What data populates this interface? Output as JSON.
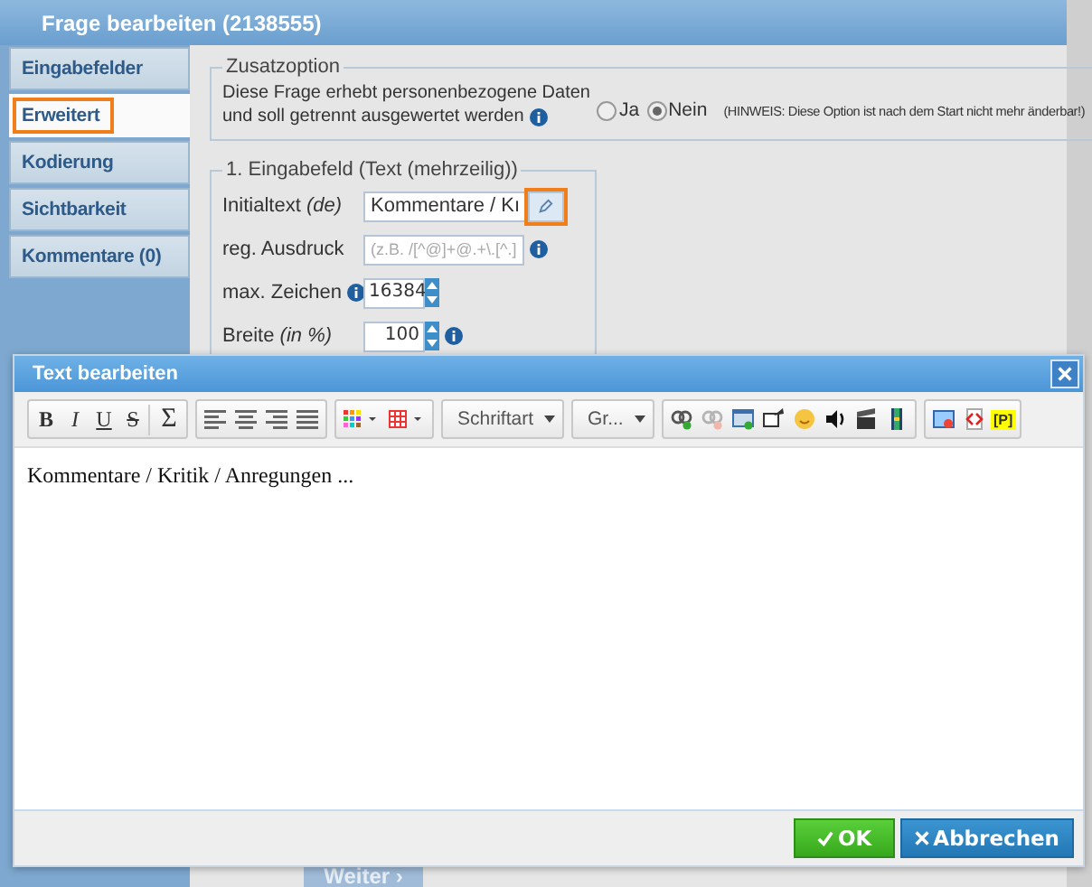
{
  "window": {
    "title": "Frage bearbeiten (2138555)"
  },
  "sidebar": {
    "items": [
      {
        "label": "Eingabefelder",
        "selected": false,
        "highlighted": false
      },
      {
        "label": "Erweitert",
        "selected": true,
        "highlighted": true
      },
      {
        "label": "Kodierung",
        "selected": false,
        "highlighted": false
      },
      {
        "label": "Sichtbarkeit",
        "selected": false,
        "highlighted": false
      },
      {
        "label": "Kommentare (0)",
        "selected": false,
        "highlighted": false
      }
    ]
  },
  "zusatzoption": {
    "legend": "Zusatzoption",
    "question_lines": [
      "Diese Frage erhebt personenbezogene Daten",
      "und soll getrennt ausgewertet werden"
    ],
    "options": [
      {
        "label": "Ja",
        "selected": false
      },
      {
        "label": "Nein",
        "selected": true
      }
    ],
    "hint": "(HINWEIS: Diese Option ist nach dem Start nicht mehr änderbar!)"
  },
  "field_settings": {
    "legend": "1. Eingabefeld (Text (mehrzeilig))",
    "rows": [
      {
        "kind": "text-edit",
        "label": "Initialtext *(de)*",
        "value": "Kommentare / Kı",
        "edit_highlighted": true
      },
      {
        "kind": "text",
        "label": "reg. Ausdruck",
        "placeholder": "(z.B. /[^@]+@.+\\.[^.]",
        "info_after_field": true
      },
      {
        "kind": "spinner",
        "label": "max. Zeichen",
        "value": "16384",
        "info_after_label": true
      },
      {
        "kind": "spinner",
        "label": "Breite *(in %)*",
        "value": "100",
        "info_after_field": true
      }
    ]
  },
  "next_button": {
    "label": "Weiter ›"
  },
  "dialog": {
    "title": "Text bearbeiten",
    "toolbar": [
      [
        {
          "kind": "bold",
          "label": "B"
        },
        {
          "kind": "italic",
          "label": "I"
        },
        {
          "kind": "underline",
          "label": "U"
        },
        {
          "kind": "strike",
          "label": "S"
        },
        {
          "kind": "sigma",
          "label": "Σ"
        }
      ],
      [
        {
          "kind": "align-left"
        },
        {
          "kind": "align-center"
        },
        {
          "kind": "align-right"
        },
        {
          "kind": "align-justify"
        }
      ],
      [
        {
          "kind": "colors"
        },
        {
          "kind": "table"
        }
      ],
      [
        {
          "kind": "dropdown",
          "label": "Schriftart"
        }
      ],
      [
        {
          "kind": "dropdown",
          "label": "Gr..."
        }
      ],
      [
        {
          "kind": "link"
        },
        {
          "kind": "unlink"
        },
        {
          "kind": "image"
        },
        {
          "kind": "embed"
        },
        {
          "kind": "smiley"
        },
        {
          "kind": "sound"
        },
        {
          "kind": "video"
        },
        {
          "kind": "film"
        }
      ],
      [
        {
          "kind": "preview"
        },
        {
          "kind": "code"
        },
        {
          "kind": "tag",
          "label": "[P]"
        }
      ]
    ],
    "content": "Kommentare / Kritik / Anregungen ...",
    "buttons": [
      {
        "kind": "confirm",
        "label": "OK"
      },
      {
        "kind": "cancel",
        "label": "Abbrechen"
      }
    ]
  }
}
